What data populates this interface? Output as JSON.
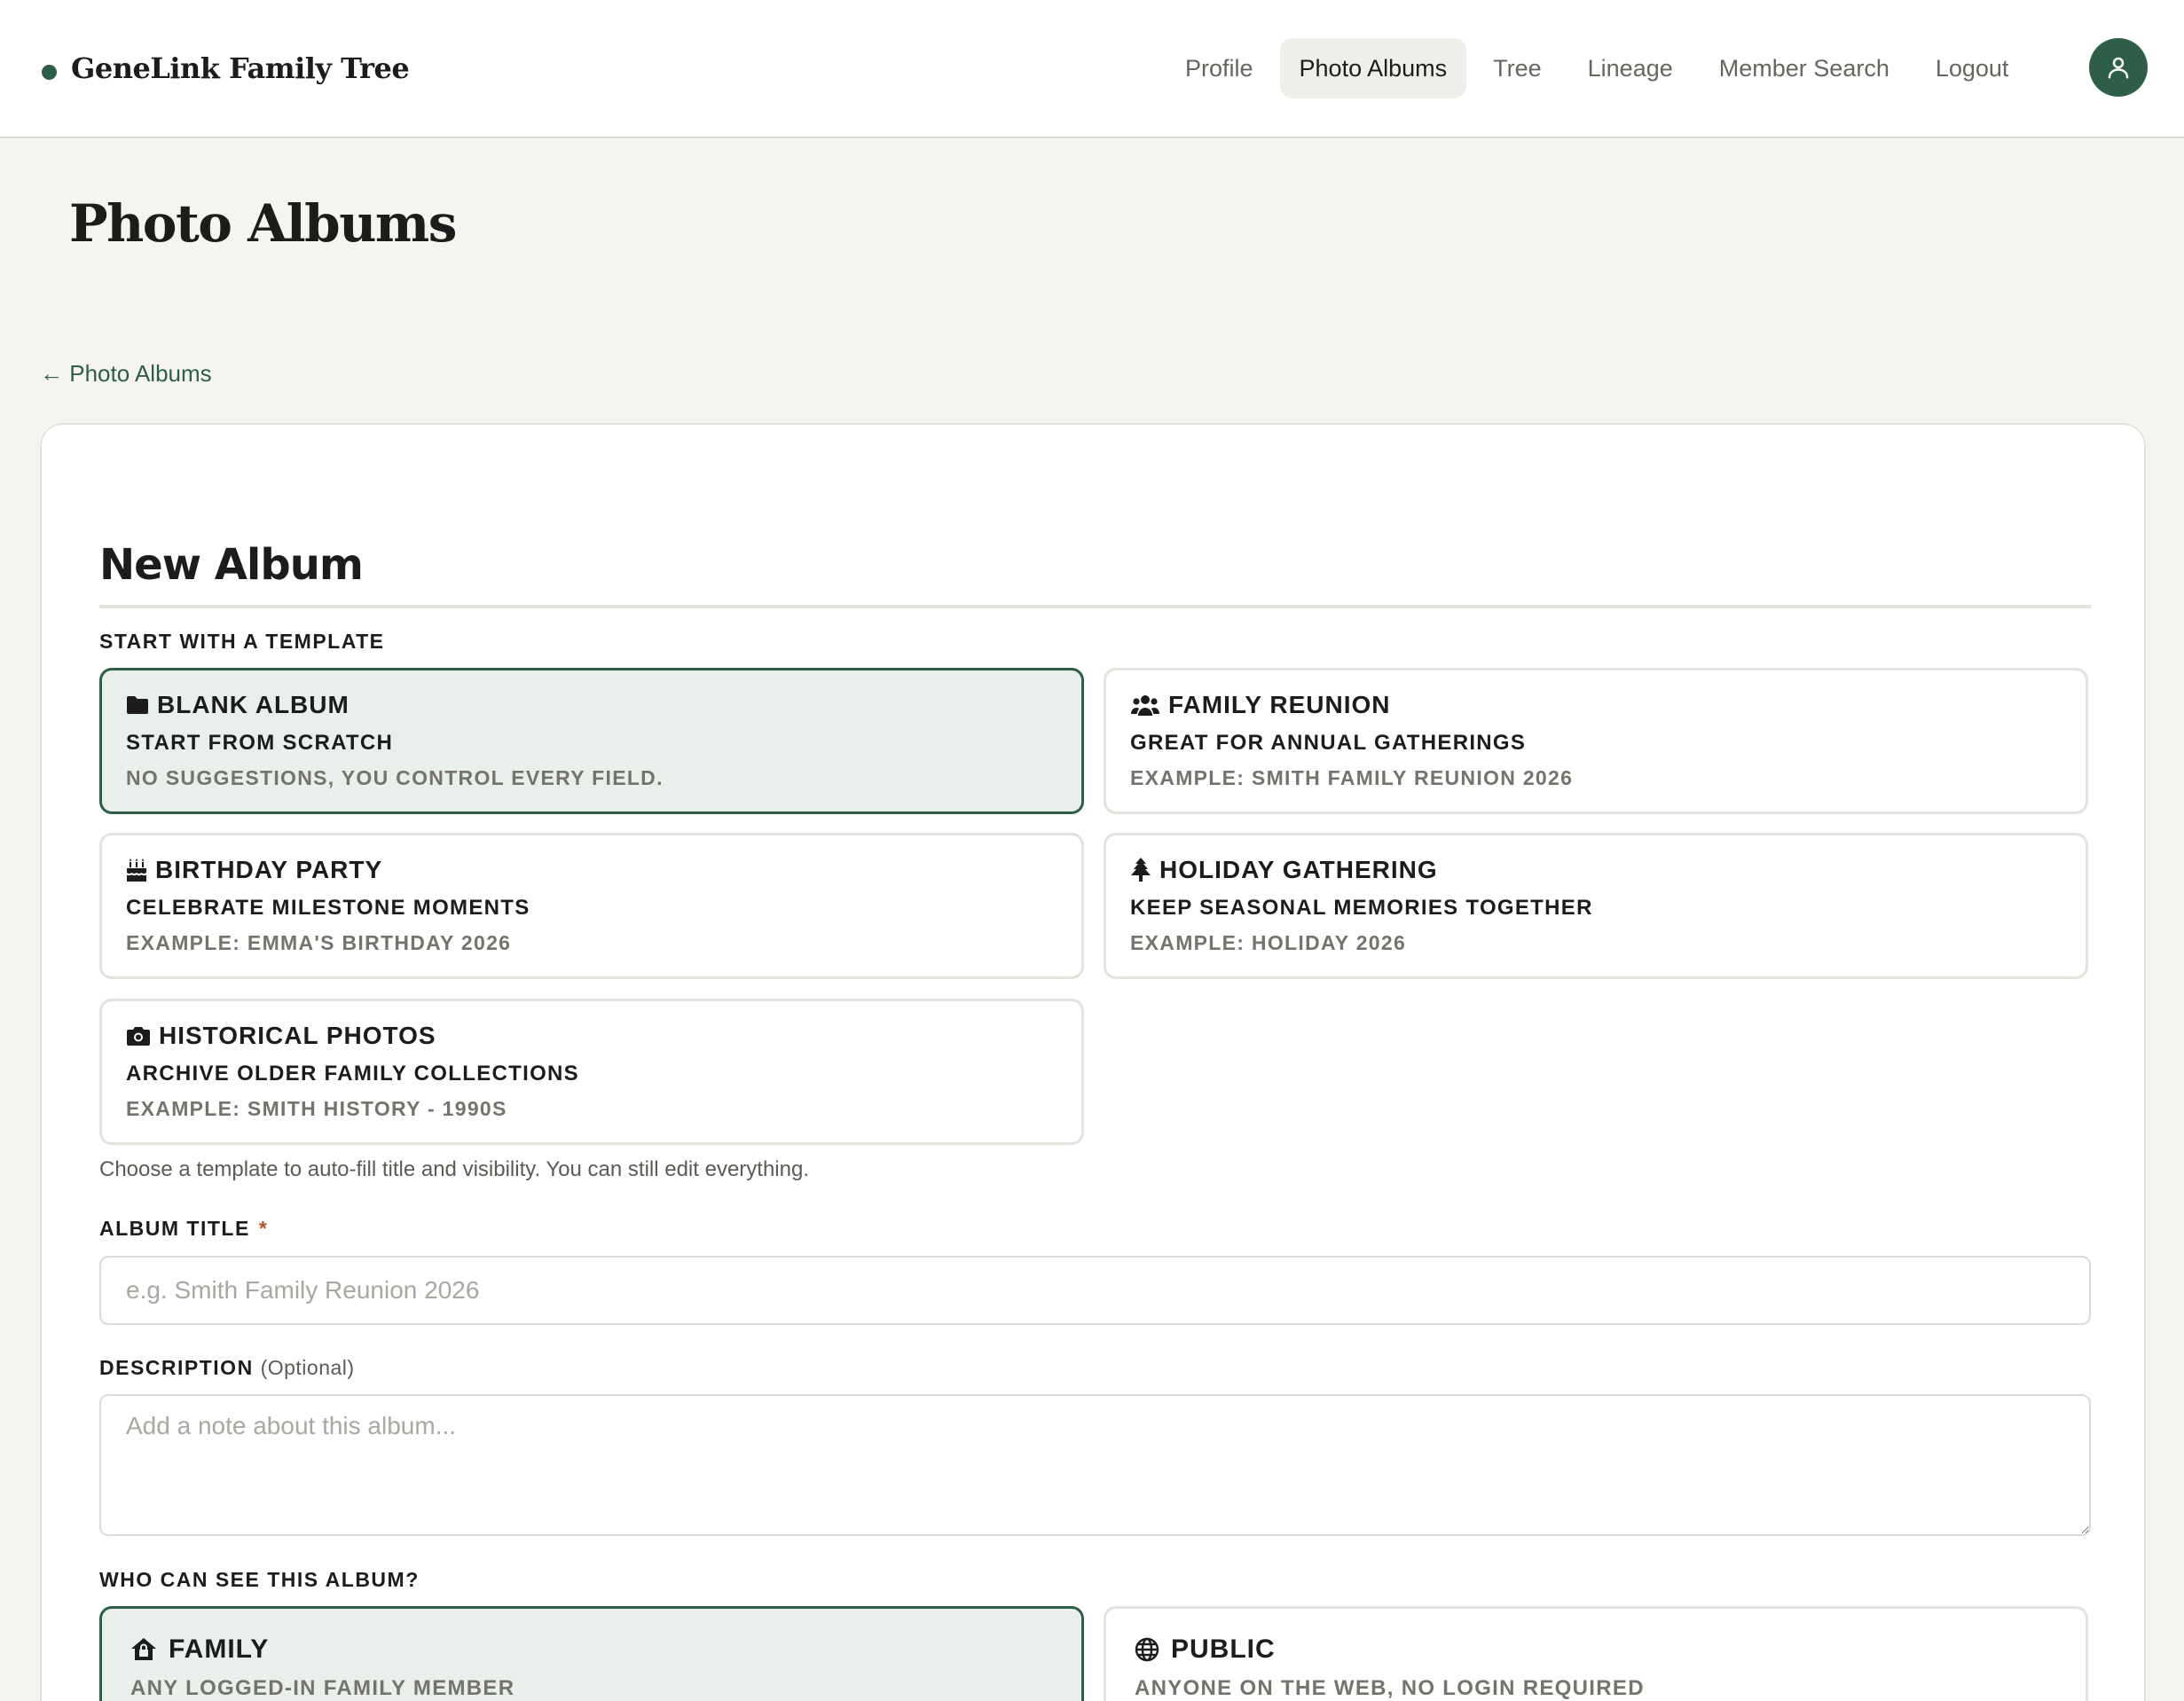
{
  "header": {
    "brand": "GeneLink Family Tree",
    "nav": [
      {
        "label": "Profile",
        "active": false
      },
      {
        "label": "Photo Albums",
        "active": true
      },
      {
        "label": "Tree",
        "active": false
      },
      {
        "label": "Lineage",
        "active": false
      },
      {
        "label": "Member Search",
        "active": false
      },
      {
        "label": "Logout",
        "active": false
      }
    ],
    "avatar_icon": "user-icon"
  },
  "page": {
    "title": "Photo Albums",
    "back_link": "← Photo Albums"
  },
  "form": {
    "title": "New Album",
    "template_section_label": "START WITH A TEMPLATE",
    "templates": [
      {
        "icon": "folder-icon",
        "name": "BLANK ALBUM",
        "subtitle": "START FROM SCRATCH",
        "example": "NO SUGGESTIONS, YOU CONTROL EVERY FIELD.",
        "selected": true
      },
      {
        "icon": "users-icon",
        "name": "FAMILY REUNION",
        "subtitle": "GREAT FOR ANNUAL GATHERINGS",
        "example": "EXAMPLE: SMITH FAMILY REUNION 2026",
        "selected": false
      },
      {
        "icon": "cake-icon",
        "name": "BIRTHDAY PARTY",
        "subtitle": "CELEBRATE MILESTONE MOMENTS",
        "example": "EXAMPLE: EMMA'S BIRTHDAY 2026",
        "selected": false
      },
      {
        "icon": "tree-icon",
        "name": "HOLIDAY GATHERING",
        "subtitle": "KEEP SEASONAL MEMORIES TOGETHER",
        "example": "EXAMPLE: HOLIDAY 2026",
        "selected": false
      },
      {
        "icon": "camera-icon",
        "name": "HISTORICAL PHOTOS",
        "subtitle": "ARCHIVE OLDER FAMILY COLLECTIONS",
        "example": "EXAMPLE: SMITH HISTORY - 1990S",
        "selected": false
      }
    ],
    "template_hint": "Choose a template to auto-fill title and visibility. You can still edit everything.",
    "title_field": {
      "label": "ALBUM TITLE",
      "required_marker": "*",
      "value": "",
      "placeholder": "e.g. Smith Family Reunion 2026"
    },
    "description_field": {
      "label": "DESCRIPTION",
      "optional_marker": "(Optional)",
      "value": "",
      "placeholder": "Add a note about this album..."
    },
    "visibility_section_label": "WHO CAN SEE THIS ALBUM?",
    "visibility_options": [
      {
        "icon": "house-lock-icon",
        "name": "FAMILY",
        "description": "ANY LOGGED-IN FAMILY MEMBER",
        "selected": true
      },
      {
        "icon": "globe-icon",
        "name": "PUBLIC",
        "description": "ANYONE ON THE WEB, NO LOGIN REQUIRED",
        "selected": false
      }
    ]
  },
  "colors": {
    "accent": "#2e5e48",
    "background": "#f5f4f0",
    "selected_fill": "#e9efeb",
    "required": "#b0542c"
  }
}
